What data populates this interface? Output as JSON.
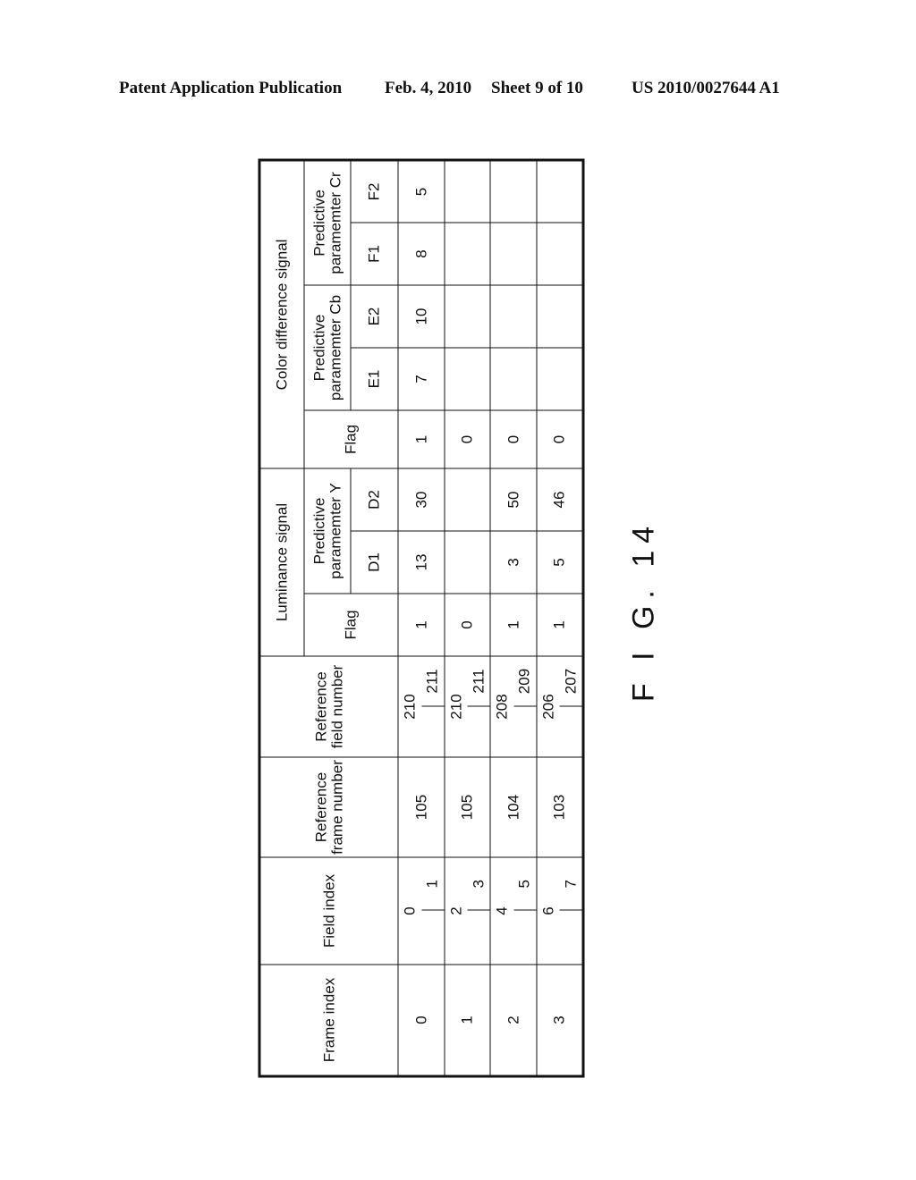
{
  "header": {
    "publication": "Patent Application Publication",
    "date": "Feb. 4, 2010",
    "sheet": "Sheet 9 of 10",
    "number": "US 2010/0027644 A1"
  },
  "table": {
    "headers": {
      "frame_index": "Frame index",
      "field_index": "Field index",
      "ref_frame_number": "Reference frame number",
      "ref_field_number": "Reference field number",
      "luminance_signal": "Luminance signal",
      "lum_flag": "Flag",
      "predictive_y": "Predictive paramemter Y",
      "d1": "D1",
      "d2": "D2",
      "color_difference_signal": "Color difference signal",
      "color_flag": "Flag",
      "predictive_cb": "Predictive paramemter Cb",
      "predictive_cr": "Predictive paramemter Cr",
      "e1": "E1",
      "e2": "E2",
      "f1": "F1",
      "f2": "F2"
    },
    "rows": [
      {
        "frame_index": "0",
        "fields": [
          "0",
          "1"
        ],
        "ref_frame": "105",
        "ref_fields": [
          "210",
          "211"
        ],
        "lum_flag": "1",
        "d1": "13",
        "d2": "30",
        "color_flag": "1",
        "e1": "7",
        "e2": "10",
        "f1": "8",
        "f2": "5"
      },
      {
        "frame_index": "1",
        "fields": [
          "2",
          "3"
        ],
        "ref_frame": "105",
        "ref_fields": [
          "210",
          "211"
        ],
        "lum_flag": "0",
        "d1": "",
        "d2": "",
        "color_flag": "0",
        "e1": "",
        "e2": "",
        "f1": "",
        "f2": ""
      },
      {
        "frame_index": "2",
        "fields": [
          "4",
          "5"
        ],
        "ref_frame": "104",
        "ref_fields": [
          "208",
          "209"
        ],
        "lum_flag": "1",
        "d1": "3",
        "d2": "50",
        "color_flag": "0",
        "e1": "",
        "e2": "",
        "f1": "",
        "f2": ""
      },
      {
        "frame_index": "3",
        "fields": [
          "6",
          "7"
        ],
        "ref_frame": "103",
        "ref_fields": [
          "206",
          "207"
        ],
        "lum_flag": "1",
        "d1": "5",
        "d2": "46",
        "color_flag": "0",
        "e1": "",
        "e2": "",
        "f1": "",
        "f2": ""
      }
    ]
  },
  "figure_label": "F I G. 14"
}
